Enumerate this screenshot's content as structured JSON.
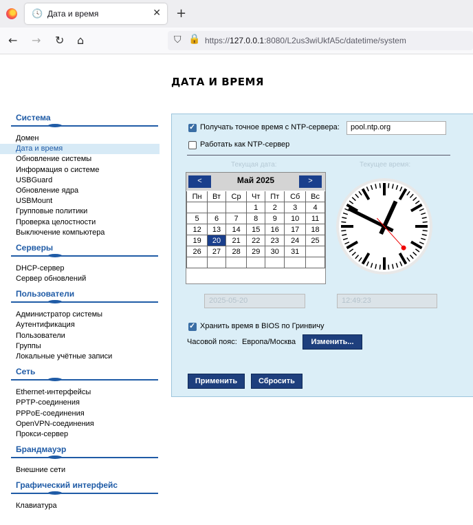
{
  "browser": {
    "tab_title": "Дата и время",
    "url_host": "127.0.0.1",
    "url_prefix": "https://",
    "url_rest": ":8080/L2us3wiUkfA5c/datetime/system"
  },
  "page": {
    "title": "ДАТА И ВРЕМЯ"
  },
  "sidebar": {
    "sections": [
      {
        "title": "Система",
        "items": [
          "Домен",
          "Дата и время",
          "Обновление системы",
          "Информация о системе",
          "USBGuard",
          "Обновление ядра",
          "USBMount",
          "Групповые политики",
          "Проверка целостности",
          "Выключение компьютера"
        ]
      },
      {
        "title": "Серверы",
        "items": [
          "DHCP-сервер",
          "Сервер обновлений"
        ]
      },
      {
        "title": "Пользователи",
        "items": [
          "Администратор системы",
          "Аутентификация",
          "Пользователи",
          "Группы",
          "Локальные учётные записи"
        ]
      },
      {
        "title": "Сеть",
        "items": [
          "Ethernet-интерфейсы",
          "PPTP-соединения",
          "PPPoE-соединения",
          "OpenVPN-соединения",
          "Прокси-сервер"
        ]
      },
      {
        "title": "Брандмауэр",
        "items": [
          "Внешние сети"
        ]
      },
      {
        "title": "Графический интерфейс",
        "items": [
          "Клавиатура"
        ]
      }
    ],
    "active_item": "Дата и время"
  },
  "form": {
    "ntp_checkbox_label": "Получать точное время с NTP-сервера:",
    "ntp_checked": true,
    "ntp_server_value": "pool.ntp.org",
    "ntp_server_mode_label": "Работать как NTP-сервер",
    "ntp_server_mode_checked": false,
    "current_date_label": "Текущая дата:",
    "current_time_label": "Текущее время:",
    "date_value": "2025-05-20",
    "time_value": "12:49:23",
    "bios_utc_label": "Хранить время в BIOS по Гринвичу",
    "bios_utc_checked": true,
    "timezone_label": "Часовой пояс:",
    "timezone_value": "Европа/Москва",
    "change_button": "Изменить...",
    "apply_button": "Применить",
    "reset_button": "Сбросить"
  },
  "calendar": {
    "month_title": "Май 2025",
    "prev": "<",
    "next": ">",
    "weekdays": [
      "Пн",
      "Вт",
      "Ср",
      "Чт",
      "Пт",
      "Сб",
      "Вс"
    ],
    "weeks": [
      [
        "",
        "",
        "",
        "1",
        "2",
        "3",
        "4"
      ],
      [
        "5",
        "6",
        "7",
        "8",
        "9",
        "10",
        "11"
      ],
      [
        "12",
        "13",
        "14",
        "15",
        "16",
        "17",
        "18"
      ],
      [
        "19",
        "20",
        "21",
        "22",
        "23",
        "24",
        "25"
      ],
      [
        "26",
        "27",
        "28",
        "29",
        "30",
        "31",
        ""
      ],
      [
        "",
        "",
        "",
        "",
        "",
        "",
        ""
      ]
    ],
    "selected_day": "20"
  },
  "clock": {
    "hours": 12,
    "minutes": 49,
    "seconds": 23
  }
}
